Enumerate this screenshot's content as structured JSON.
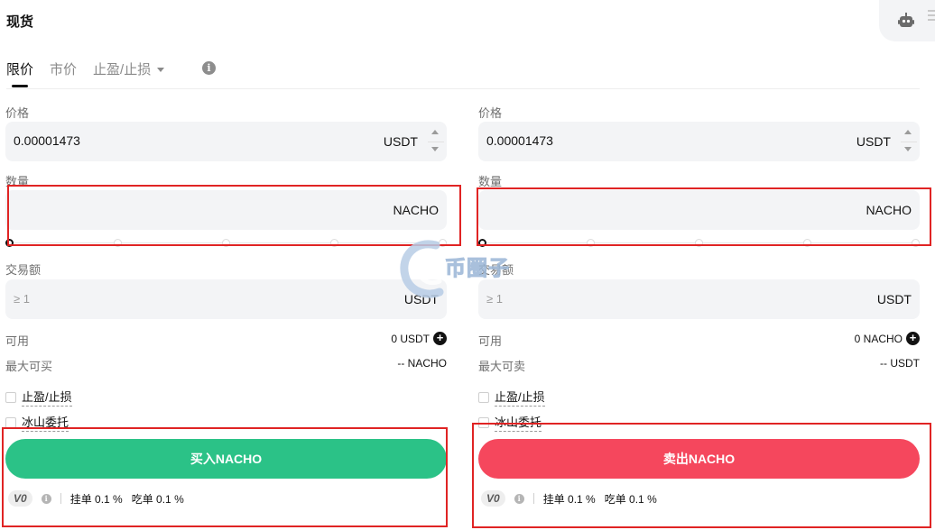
{
  "header": {
    "title": "现货",
    "robot_icon": "robot-icon",
    "menu_icon": "menu-icon"
  },
  "tabs": [
    {
      "label": "限价",
      "active": true
    },
    {
      "label": "市价",
      "active": false
    },
    {
      "label": "止盈/止损",
      "active": false,
      "dropdown": true
    }
  ],
  "buy": {
    "price_label": "价格",
    "price_value": "0.00001473",
    "price_unit": "USDT",
    "amount_label": "数量",
    "amount_value": "",
    "amount_unit": "NACHO",
    "total_label": "交易额",
    "total_placeholder": "≥ 1",
    "total_unit": "USDT",
    "available_label": "可用",
    "available_value": "0 USDT",
    "max_label": "最大可买",
    "max_value": "-- NACHO",
    "tpsl_label": "止盈/止损",
    "iceberg_label": "冰山委托",
    "button_label": "买入NACHO",
    "button_color": "#2bc287",
    "vip_level": "V0",
    "maker_fee": "挂单 0.1 %",
    "taker_fee": "吃单 0.1 %"
  },
  "sell": {
    "price_label": "价格",
    "price_value": "0.00001473",
    "price_unit": "USDT",
    "amount_label": "数量",
    "amount_value": "",
    "amount_unit": "NACHO",
    "total_label": "交易额",
    "total_placeholder": "≥ 1",
    "total_unit": "USDT",
    "available_label": "可用",
    "available_value": "0 NACHO",
    "max_label": "最大可卖",
    "max_value": "-- USDT",
    "tpsl_label": "止盈/止损",
    "iceberg_label": "冰山委托",
    "button_label": "卖出NACHO",
    "button_color": "#f5475d",
    "vip_level": "V0",
    "maker_fee": "挂单 0.1 %",
    "taker_fee": "吃单 0.1 %"
  },
  "slider_position": 0,
  "watermark_text": "币圈子",
  "highlight_color": "#e02424"
}
